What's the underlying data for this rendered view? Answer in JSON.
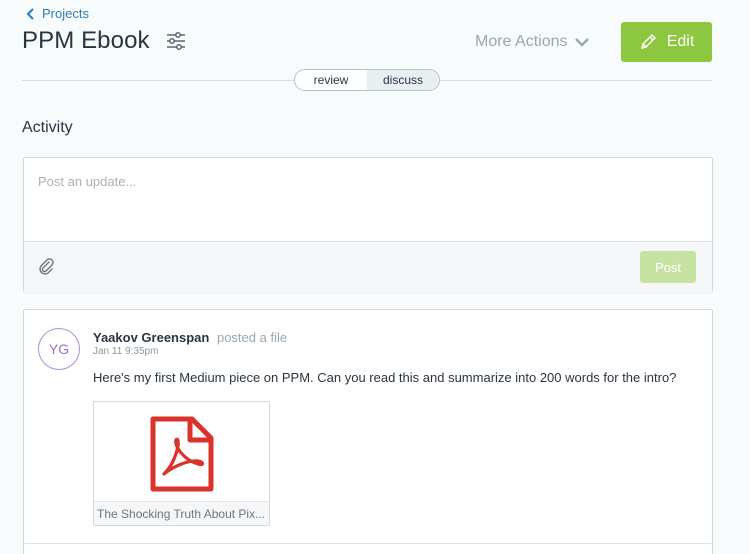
{
  "header": {
    "back_label": "Projects",
    "title": "PPM Ebook",
    "more_actions_label": "More Actions",
    "edit_label": "Edit"
  },
  "tabs": [
    {
      "label": "review",
      "active": false
    },
    {
      "label": "discuss",
      "active": true
    }
  ],
  "activity": {
    "heading": "Activity",
    "composer": {
      "placeholder": "Post an update...",
      "post_label": "Post"
    },
    "feed": [
      {
        "avatar_initials": "YG",
        "author": "Yaakov Greenspan",
        "action": "posted a file",
        "timestamp": "Jan 11 9:35pm",
        "message": "Here's my first Medium piece on PPM. Can you read this and summarize into 200 words for the intro?",
        "attachment_name": "The Shocking Truth About Pix..."
      }
    ]
  },
  "colors": {
    "accent_green": "#8dc63f",
    "link_blue": "#2f7bb8",
    "avatar_purple": "#9b6fce",
    "pdf_red": "#d9332c"
  },
  "icons": {
    "back": "chevron-left-icon",
    "filter": "sliders-icon",
    "more": "chevron-down-icon",
    "edit": "pencil-icon",
    "attach": "paperclip-icon",
    "file": "pdf-file-icon"
  }
}
